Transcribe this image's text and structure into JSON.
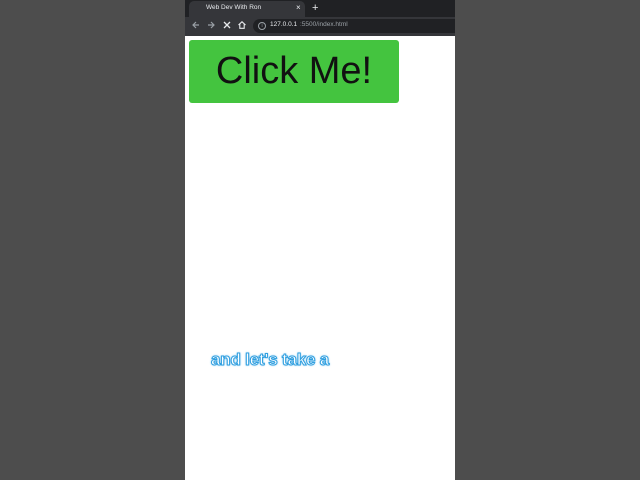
{
  "browser": {
    "tab_title": "Web Dev With Ron",
    "tab_close": "×",
    "new_tab": "+",
    "url_host": "127.0.0.1",
    "url_rest": ":5500/index.html",
    "icons": {
      "back": "back-arrow-icon",
      "forward": "forward-arrow-icon",
      "stop": "stop-loading-icon",
      "home": "home-icon",
      "info": "info-icon"
    }
  },
  "page": {
    "button_label": "Click Me!",
    "button_color": "#44c43f"
  },
  "caption": {
    "text": "and let's take a",
    "stroke_color": "#2f9fe0"
  }
}
